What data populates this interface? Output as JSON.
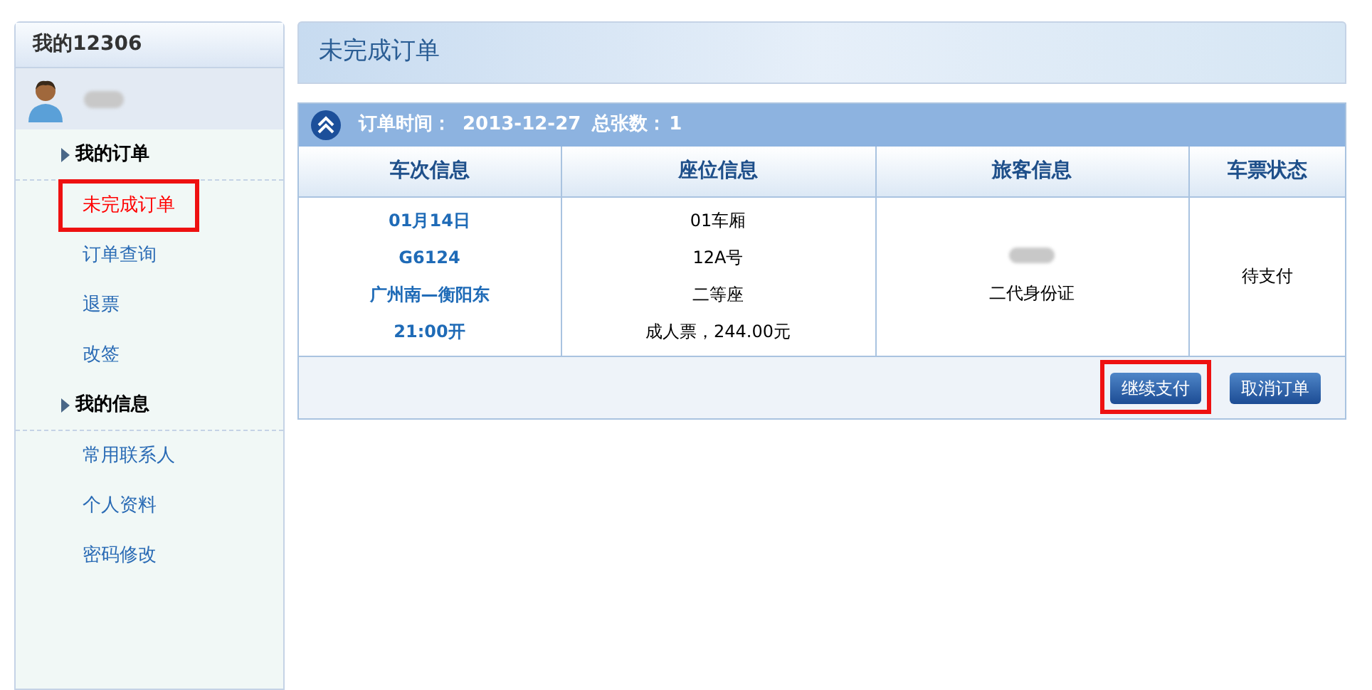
{
  "sidebar": {
    "title": "我的12306",
    "user": {
      "name_redacted": true
    },
    "sections": [
      {
        "label": "我的订单",
        "items": [
          {
            "label": "未完成订单",
            "selected": true,
            "annotated": true
          },
          {
            "label": "订单查询",
            "selected": false,
            "annotated": false
          },
          {
            "label": "退票",
            "selected": false,
            "annotated": false
          },
          {
            "label": "改签",
            "selected": false,
            "annotated": false
          }
        ]
      },
      {
        "label": "我的信息",
        "items": [
          {
            "label": "常用联系人",
            "selected": false,
            "annotated": false
          },
          {
            "label": "个人资料",
            "selected": false,
            "annotated": false
          },
          {
            "label": "密码修改",
            "selected": false,
            "annotated": false
          }
        ]
      }
    ]
  },
  "page_title": "未完成订单",
  "order": {
    "time_label": "订单时间：",
    "time": "2013-12-27",
    "count_label": "总张数：",
    "count": "1",
    "columns": [
      "车次信息",
      "座位信息",
      "旅客信息",
      "车票状态"
    ],
    "rows": [
      {
        "train": [
          "01月14日",
          "G6124",
          "广州南—衡阳东",
          "21:00开"
        ],
        "seat": [
          "01车厢",
          "12A号",
          "二等座",
          "成人票，244.00元"
        ],
        "passenger": {
          "name_redacted": true,
          "id_type": "二代身份证"
        },
        "status": "待支付"
      }
    ],
    "buttons": [
      {
        "label": "继续支付",
        "annotated": true
      },
      {
        "label": "取消订单",
        "annotated": false
      }
    ]
  }
}
